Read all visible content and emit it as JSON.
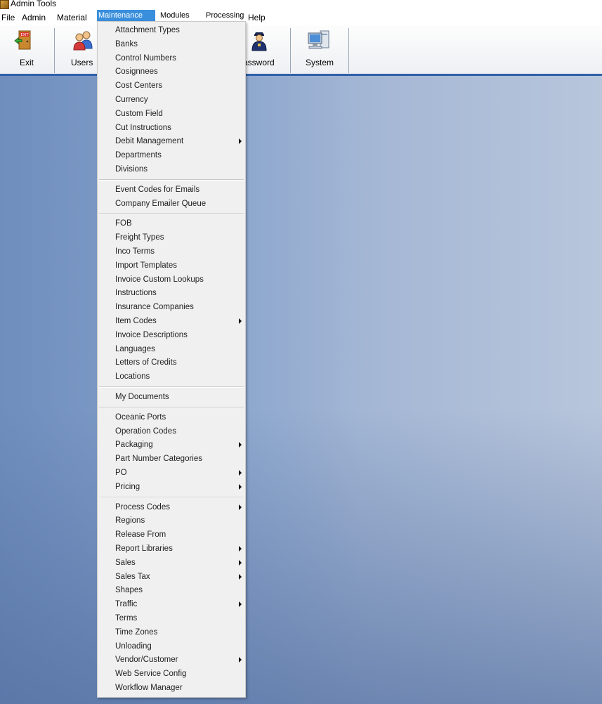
{
  "window": {
    "title": "Admin Tools"
  },
  "menubar": {
    "items": [
      "File",
      "Admin",
      "Material",
      "Maintenance",
      "Modules",
      "Processing",
      "Help"
    ]
  },
  "toolbar": {
    "buttons": [
      {
        "label": "Exit",
        "icon": "exit-door-icon"
      },
      {
        "label": "Users",
        "icon": "users-icon"
      },
      {
        "label": "assword",
        "icon": "police-officer-icon"
      },
      {
        "label": "System",
        "icon": "computer-icon"
      }
    ]
  },
  "maintenance_menu": {
    "groups": [
      [
        {
          "label": "Attachment Types",
          "submenu": false
        },
        {
          "label": "Banks",
          "submenu": false
        },
        {
          "label": "Control Numbers",
          "submenu": false
        },
        {
          "label": "Cosignnees",
          "submenu": false
        },
        {
          "label": "Cost Centers",
          "submenu": false
        },
        {
          "label": "Currency",
          "submenu": false
        },
        {
          "label": "Custom Field",
          "submenu": false
        },
        {
          "label": "Cut Instructions",
          "submenu": false
        },
        {
          "label": "Debit Management",
          "submenu": true
        },
        {
          "label": "Departments",
          "submenu": false
        },
        {
          "label": "Divisions",
          "submenu": false
        }
      ],
      [
        {
          "label": "Event Codes for Emails",
          "submenu": false
        },
        {
          "label": "Company Emailer Queue",
          "submenu": false
        }
      ],
      [
        {
          "label": "FOB",
          "submenu": false
        },
        {
          "label": "Freight Types",
          "submenu": false
        },
        {
          "label": "Inco Terms",
          "submenu": false
        },
        {
          "label": "Import Templates",
          "submenu": false
        },
        {
          "label": "Invoice Custom Lookups",
          "submenu": false
        },
        {
          "label": "Instructions",
          "submenu": false
        },
        {
          "label": "Insurance Companies",
          "submenu": false
        },
        {
          "label": "Item Codes",
          "submenu": true
        },
        {
          "label": "Invoice Descriptions",
          "submenu": false
        },
        {
          "label": "Languages",
          "submenu": false
        },
        {
          "label": "Letters of Credits",
          "submenu": false
        },
        {
          "label": "Locations",
          "submenu": false
        }
      ],
      [
        {
          "label": "My Documents",
          "submenu": false
        }
      ],
      [
        {
          "label": "Oceanic Ports",
          "submenu": false
        },
        {
          "label": "Operation Codes",
          "submenu": false
        },
        {
          "label": "Packaging",
          "submenu": true
        },
        {
          "label": "Part Number Categories",
          "submenu": false
        },
        {
          "label": "PO",
          "submenu": true
        },
        {
          "label": "Pricing",
          "submenu": true
        }
      ],
      [
        {
          "label": "Process Codes",
          "submenu": true
        },
        {
          "label": "Regions",
          "submenu": false
        },
        {
          "label": "Release From",
          "submenu": false
        },
        {
          "label": "Report Libraries",
          "submenu": true
        },
        {
          "label": "Sales",
          "submenu": true
        },
        {
          "label": "Sales Tax",
          "submenu": true
        },
        {
          "label": "Shapes",
          "submenu": false
        },
        {
          "label": "Traffic",
          "submenu": true
        },
        {
          "label": "Terms",
          "submenu": false
        },
        {
          "label": "Time Zones",
          "submenu": false
        },
        {
          "label": "Unloading",
          "submenu": false
        },
        {
          "label": "Vendor/Customer",
          "submenu": true
        },
        {
          "label": "Web Service Config",
          "submenu": false
        },
        {
          "label": "Workflow Manager",
          "submenu": false
        }
      ]
    ]
  }
}
